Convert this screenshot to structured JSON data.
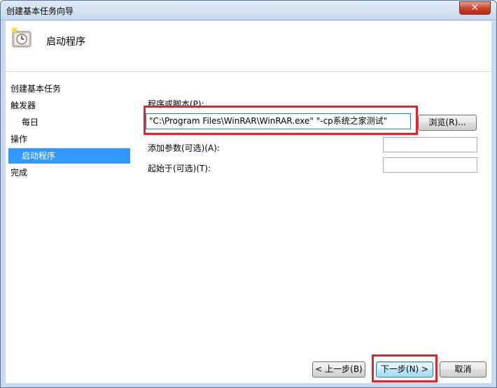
{
  "window": {
    "title": "创建基本任务向导",
    "close_label": "✕"
  },
  "header": {
    "title": "启动程序",
    "icon": "clock-task-icon"
  },
  "nav": {
    "items": [
      {
        "label": "创建基本任务"
      },
      {
        "label": "触发器"
      },
      {
        "label": "每日"
      },
      {
        "label": "操作"
      },
      {
        "label": "启动程序"
      },
      {
        "label": "完成"
      }
    ]
  },
  "form": {
    "program_label": "程序或脚本(P):",
    "program_value": "\"C:\\Program Files\\WinRAR\\WinRAR.exe\" \"-cp系统之家测试\"",
    "browse_label": "浏览(R)...",
    "args_label": "添加参数(可选)(A):",
    "args_value": "",
    "start_in_label": "起始于(可选)(T):",
    "start_in_value": ""
  },
  "footer": {
    "back_label": "< 上一步(B)",
    "next_label": "下一步(N) >",
    "cancel_label": "取消"
  },
  "colors": {
    "selection": "#3399ff",
    "annotation": "#e2232f"
  }
}
